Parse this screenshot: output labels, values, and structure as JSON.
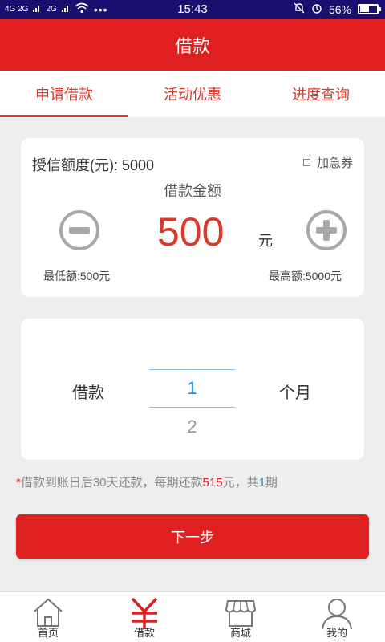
{
  "status_bar": {
    "network_1": "4G 2G",
    "network_2": "2G",
    "time": "15:43",
    "battery": "56%",
    "battery_level": 0.56
  },
  "title": "借款",
  "tabs": [
    {
      "label": "申请借款",
      "active": true
    },
    {
      "label": "活动优惠",
      "active": false
    },
    {
      "label": "进度查询",
      "active": false
    }
  ],
  "credit_card": {
    "credit_limit": "授信额度(元): 5000",
    "urgent_coupon": "加急券",
    "amount_label": "借款金额",
    "amount": "500",
    "unit": "元",
    "min_label": "最低额:500元",
    "max_label": "最高额:5000元"
  },
  "term_card": {
    "loan_label": "借款",
    "selected": "1",
    "next_option": "2",
    "month_label": "个月"
  },
  "note": {
    "star": "*",
    "text_1": "借款到账日后30天还款，每期还款",
    "repayment": "515",
    "text_2": "元，共",
    "periods": "1",
    "text_3": "期"
  },
  "next_button": "下一步",
  "bottom_nav": [
    {
      "label": "首页",
      "icon": "home-icon"
    },
    {
      "label": "借款",
      "icon": "yen-icon",
      "active": true
    },
    {
      "label": "商城",
      "icon": "store-icon"
    },
    {
      "label": "我的",
      "icon": "user-icon"
    }
  ],
  "colors": {
    "brand_red": "#e02020",
    "accent_blue": "#1e88c8",
    "status_bar": "#1a0f6e"
  }
}
